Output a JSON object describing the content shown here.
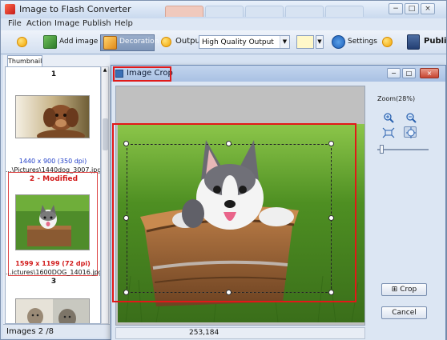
{
  "window": {
    "title": "Image to Flash Converter",
    "controls": [
      "−",
      "□",
      "×"
    ]
  },
  "menu": [
    "File",
    "Action",
    "Image",
    "Publish",
    "Help"
  ],
  "toolbar": {
    "add_image": "Add image",
    "decoration": "Decoration",
    "output_label": "Output:",
    "output_value": "High Quality Output",
    "settings": "Settings",
    "publish": "Publis"
  },
  "left_panel": {
    "tab": "Thumbnail",
    "items": [
      {
        "number": "1",
        "info": "1440 x 900 (350 dpi)",
        "path": "...\\Pictures\\1440dog_3007.jpg"
      },
      {
        "number": "2 - Modified",
        "info": "1599 x 1199 (72 dpi)",
        "path": "...ictures\\1600DOG_14016.jpg"
      },
      {
        "number": "3"
      }
    ],
    "status": "Images 2 /8"
  },
  "dialog": {
    "title": "Image Crop",
    "zoom": "Zoom(28%)",
    "coords": "253,184",
    "crop": "Crop",
    "cancel": "Cancel",
    "zoom_slider_fraction": 0.05
  },
  "colors": {
    "highlight": "#e21818",
    "modified_text": "#d11a1a",
    "info_text": "#2340c8",
    "swatch": "#fff8c9"
  }
}
